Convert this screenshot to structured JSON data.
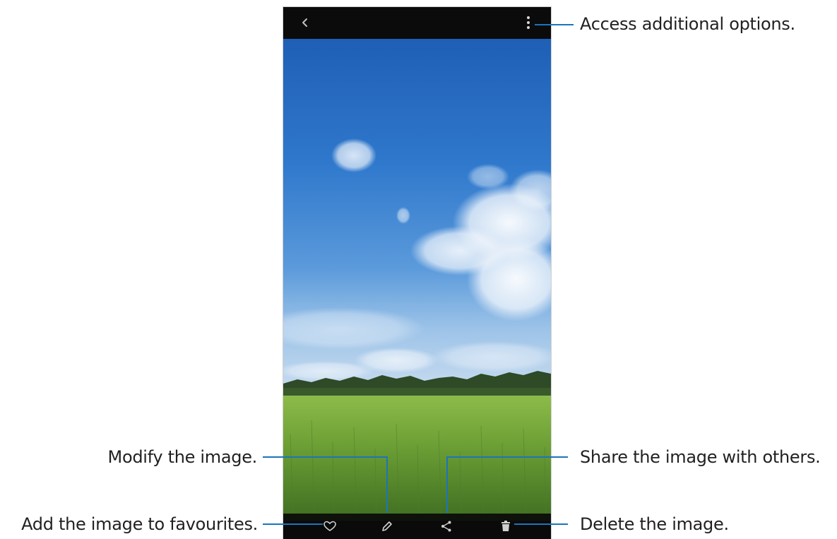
{
  "callouts": {
    "more_options": "Access additional options.",
    "modify": "Modify the image.",
    "share": "Share the image with others.",
    "favourite": "Add the image to favourites.",
    "delete": "Delete the image."
  },
  "toolbar": {
    "back_icon": "chevron-left-icon",
    "more_icon": "more-vertical-icon",
    "bottom_icons": [
      "heart-icon",
      "pencil-icon",
      "share-icon",
      "trash-icon"
    ]
  },
  "colors": {
    "leader_line": "#1b75bc",
    "bar_background": "#0b0b0b",
    "sky": "#3a73c4",
    "field": "#6a9a33"
  }
}
